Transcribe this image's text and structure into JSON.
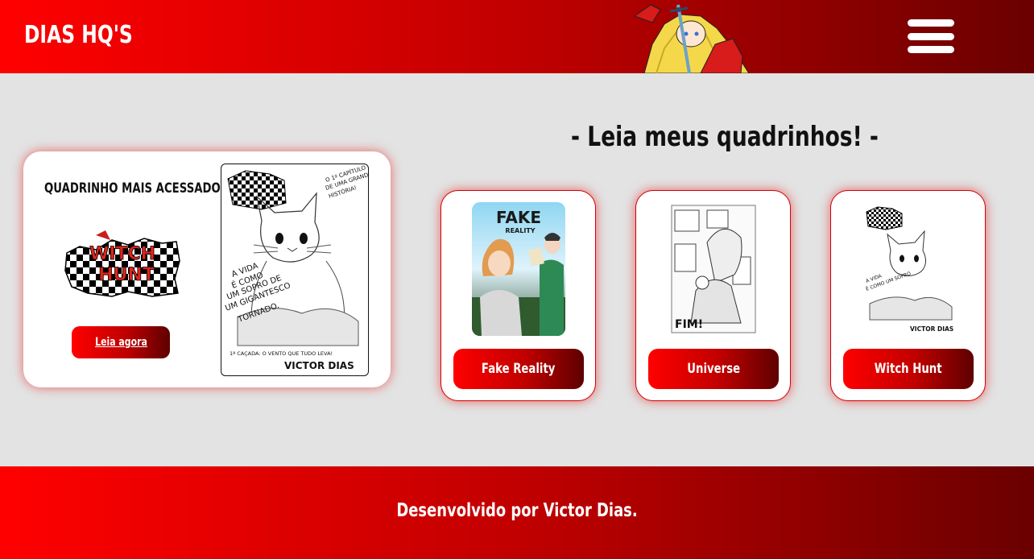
{
  "header": {
    "brand": "DIAS HQ'S",
    "menu_icon": "hamburger-menu-icon"
  },
  "featured": {
    "label": "QUADRINHO MAIS ACESSADO:",
    "logo_text_line1": "WITCH",
    "logo_text_line2": "HUNT",
    "button_label": "Leia agora",
    "cover": {
      "caption_top": "O 1º CAPÍTULO DE UMA GRANDE HISTÓRIA!",
      "caption_mid": "A VIDA É COMO UM SOPRO DE UM GIGANTESCO TORNADO.",
      "caption_bottom": "1ª CAÇADA: O VENTO QUE TUDO LEVA!",
      "author": "VICTOR DIAS"
    }
  },
  "section_title": "- Leia meus quadrinhos! -",
  "comics": [
    {
      "button_label": "Fake Reality",
      "cover_title": "FAKE",
      "cover_subtitle": "REALITY"
    },
    {
      "button_label": "Universe",
      "cover_end_text": "FIM!"
    },
    {
      "button_label": "Witch Hunt",
      "cover_author": "VICTOR DIAS"
    }
  ],
  "footer": {
    "text": "Desenvolvido por Victor Dias."
  },
  "colors": {
    "accent_red": "#ff0000",
    "dark_red": "#6a0000",
    "background": "#e3e3e3"
  }
}
